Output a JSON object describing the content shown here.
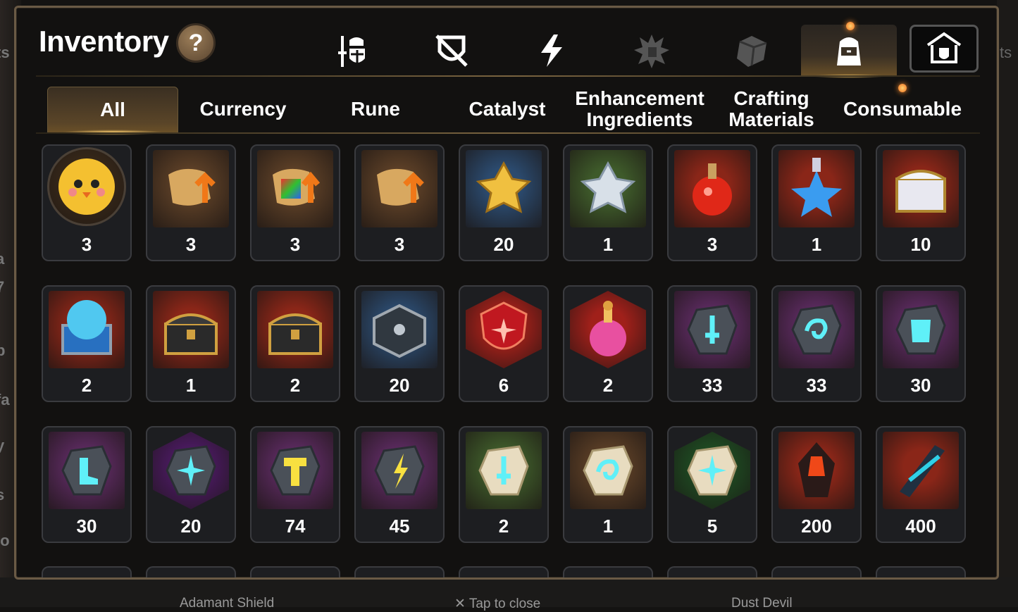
{
  "header": {
    "title": "Inventory",
    "help_label": "?"
  },
  "icon_tabs": [
    {
      "name": "hero-equipment-tab",
      "icon": "knight-sword-shield-icon",
      "active": false
    },
    {
      "name": "no-equipment-tab",
      "icon": "crossed-shield-icon",
      "active": false
    },
    {
      "name": "artifact-tab",
      "icon": "lightning-icon",
      "active": false
    },
    {
      "name": "rune-tab",
      "icon": "spiky-emblem-icon",
      "active": false
    },
    {
      "name": "cube-tab",
      "icon": "cube-icon",
      "active": false
    },
    {
      "name": "backpack-tab",
      "icon": "backpack-icon",
      "active": true
    },
    {
      "name": "storage-tab",
      "icon": "house-shield-icon",
      "active": false
    }
  ],
  "category_tabs": [
    {
      "label": "All",
      "active": true
    },
    {
      "label": "Currency",
      "active": false
    },
    {
      "label": "Rune",
      "active": false
    },
    {
      "label": "Catalyst",
      "active": false
    },
    {
      "label": "Enhancement\nIngredients",
      "active": false
    },
    {
      "label": "Crafting\nMaterials",
      "active": false
    },
    {
      "label": "Consumable",
      "active": false
    }
  ],
  "items": [
    {
      "icon": "chick-portrait-icon",
      "count": "3",
      "bg": "#3a2a1a"
    },
    {
      "icon": "scroll-upgrade-icon",
      "count": "3",
      "bg": "#5a3e26"
    },
    {
      "icon": "rainbow-scroll-icon",
      "count": "3",
      "bg": "#5a3e26"
    },
    {
      "icon": "scroll-upgrade-icon",
      "count": "3",
      "bg": "#5a3e26"
    },
    {
      "icon": "gold-flower-crystal-icon",
      "count": "20",
      "bg": "#2b4a6e"
    },
    {
      "icon": "silver-flower-crystal-icon",
      "count": "1",
      "bg": "#3e5a2a"
    },
    {
      "icon": "red-potion-icon",
      "count": "3",
      "bg": "#8a2618"
    },
    {
      "icon": "blue-star-potion-icon",
      "count": "1",
      "bg": "#8a2618"
    },
    {
      "icon": "white-gold-chest-icon",
      "count": "10",
      "bg": "#8a2618"
    },
    {
      "icon": "blue-chest-icon",
      "count": "2",
      "bg": "#8a2618"
    },
    {
      "icon": "gold-chest-icon",
      "count": "1",
      "bg": "#8a2618"
    },
    {
      "icon": "gold-chest-icon",
      "count": "2",
      "bg": "#8a2618"
    },
    {
      "icon": "silver-chest-icon",
      "count": "20",
      "bg": "#2b4a6e"
    },
    {
      "icon": "red-shield-gem-icon",
      "count": "6",
      "bg": "#a0201a"
    },
    {
      "icon": "pink-potion-icon",
      "count": "2",
      "bg": "#a0201a"
    },
    {
      "icon": "sword-rune-stone-icon",
      "count": "33",
      "bg": "#5a2a5e"
    },
    {
      "icon": "swirl-rune-stone-icon",
      "count": "33",
      "bg": "#5a2a5e"
    },
    {
      "icon": "armor-rune-stone-icon",
      "count": "30",
      "bg": "#5a2a5e"
    },
    {
      "icon": "boot-rune-stone-icon",
      "count": "30",
      "bg": "#5a2a5e"
    },
    {
      "icon": "star-rune-stone-icon",
      "count": "20",
      "bg": "#4a1a60"
    },
    {
      "icon": "hammer-rune-stone-icon",
      "count": "74",
      "bg": "#5a2a5e"
    },
    {
      "icon": "lightning-rune-stone-icon",
      "count": "45",
      "bg": "#5a2a5e"
    },
    {
      "icon": "sword-white-stone-icon",
      "count": "2",
      "bg": "#3e5a2a"
    },
    {
      "icon": "swirl-white-stone-icon",
      "count": "1",
      "bg": "#5a3e26"
    },
    {
      "icon": "star-white-stone-icon",
      "count": "5",
      "bg": "#1e4a22"
    },
    {
      "icon": "ember-crystal-icon",
      "count": "200",
      "bg": "#8a2618"
    },
    {
      "icon": "blue-claw-crystal-icon",
      "count": "400",
      "bg": "#8a2618"
    }
  ],
  "background_text": {
    "left_letters": [
      "ts",
      "a",
      "7",
      "p",
      "fa",
      "y",
      "s",
      "lo"
    ],
    "right_letters": "ts",
    "bottom_left": "Adamant Shield",
    "bottom_center": "✕ Tap to close",
    "bottom_right": "Dust Devil"
  },
  "colors": {
    "panel_border": "#6a5a45",
    "accent_gold": "#ffcc66",
    "slot_bg": "#1d1e21"
  }
}
